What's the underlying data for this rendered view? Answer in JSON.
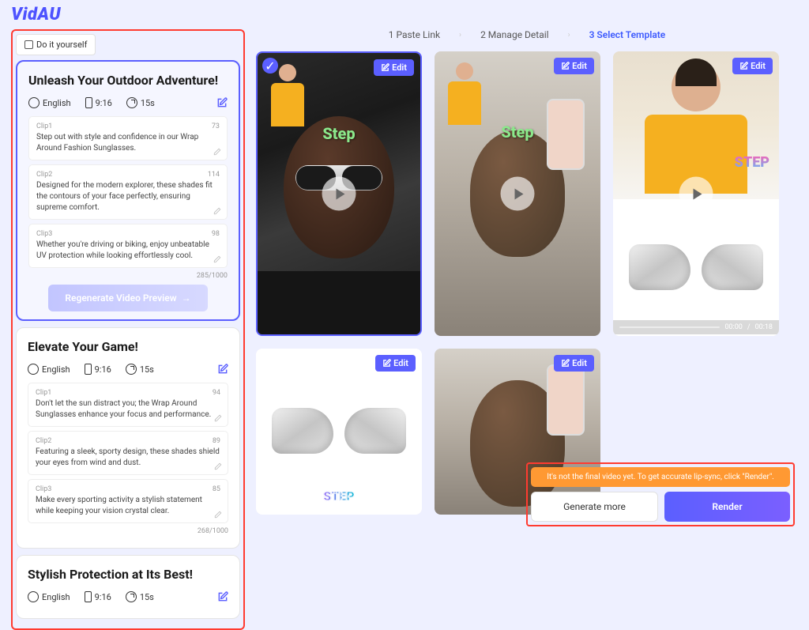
{
  "brand": "VidAU",
  "diy_label": "Do it yourself",
  "steps": [
    {
      "num": "1",
      "label": "Paste Link"
    },
    {
      "num": "2",
      "label": "Manage Detail"
    },
    {
      "num": "3",
      "label": "Select Template"
    }
  ],
  "cards": [
    {
      "title": "Unleash Your Outdoor Adventure!",
      "language": "English",
      "ratio": "9:16",
      "duration": "15s",
      "clips": [
        {
          "label": "Clip1",
          "count": "73",
          "text": "Step out with style and confidence in our Wrap Around Fashion Sunglasses."
        },
        {
          "label": "Clip2",
          "count": "114",
          "text": "Designed for the modern explorer, these shades fit the contours of your face perfectly, ensuring supreme comfort."
        },
        {
          "label": "Clip3",
          "count": "98",
          "text": "Whether you're driving or biking, enjoy unbeatable UV protection while looking effortlessly cool."
        }
      ],
      "counter": "285/1000",
      "regen_label": "Regenerate Video Preview"
    },
    {
      "title": "Elevate Your Game!",
      "language": "English",
      "ratio": "9:16",
      "duration": "15s",
      "clips": [
        {
          "label": "Clip1",
          "count": "94",
          "text": "Don't let the sun distract you; the Wrap Around Sunglasses enhance your focus and performance."
        },
        {
          "label": "Clip2",
          "count": "89",
          "text": " Featuring a sleek, sporty design, these shades shield your eyes from wind and dust."
        },
        {
          "label": "Clip3",
          "count": "85",
          "text": "Make every sporting activity a stylish statement while keeping your vision crystal clear."
        }
      ],
      "counter": "268/1000"
    },
    {
      "title": "Stylish Protection at Its Best!",
      "language": "English",
      "ratio": "9:16",
      "duration": "15s"
    }
  ],
  "edit_label": "Edit",
  "overlay_text": "Step",
  "overlay_text_caps": "STEP",
  "time": {
    "current": "00:00",
    "total": "00:18"
  },
  "tooltip": "It's not the final video yet. To get accurate lip-sync, click \"Render\".",
  "gen_more": "Generate more",
  "render": "Render"
}
